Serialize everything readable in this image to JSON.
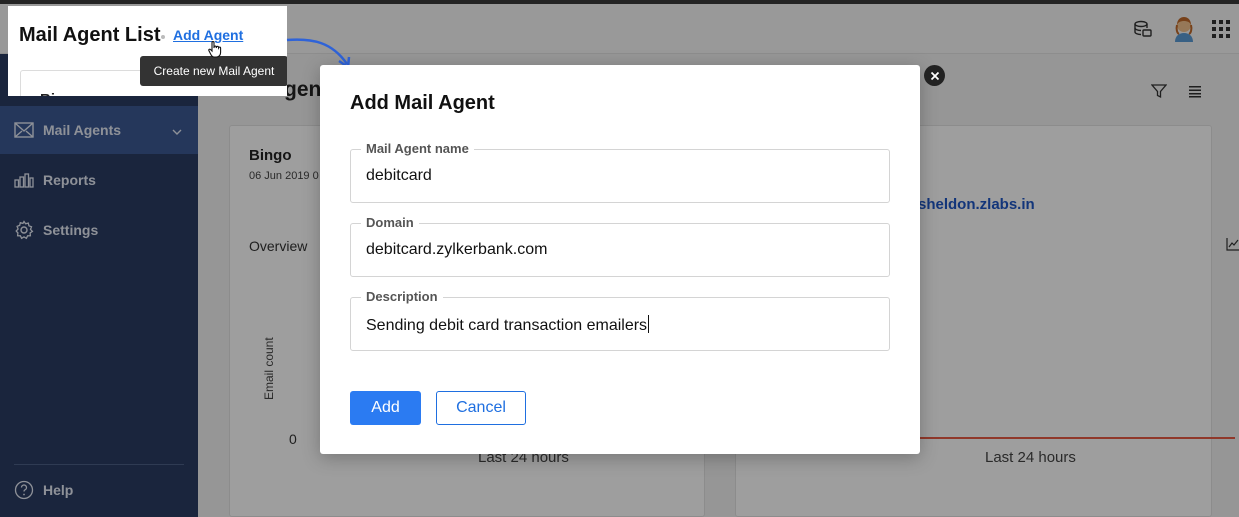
{
  "inset": {
    "title": "Mail Agent List",
    "add_link": "Add Agent",
    "tooltip": "Create new Mail Agent",
    "card_text": "Bi"
  },
  "sidebar": {
    "items": [
      {
        "label": "Mail Agents",
        "icon": "mail-icon"
      },
      {
        "label": "Reports",
        "icon": "reports-icon"
      },
      {
        "label": "Settings",
        "icon": "gear-icon"
      }
    ],
    "help_label": "Help"
  },
  "background": {
    "page_title_fragment": "gent",
    "agent_name": "Bingo",
    "agent_date": "06 Jun 2019 0",
    "overview_tab": "Overview",
    "y_axis_label": "Email count",
    "y_zero": "0",
    "x_label_left": "Last 24 hours",
    "x_label_right": "Last 24 hours",
    "domain_link": "sheldon.zlabs.in"
  },
  "modal": {
    "title": "Add Mail Agent",
    "fields": [
      {
        "label": "Mail Agent name",
        "value": "debitcard"
      },
      {
        "label": "Domain",
        "value": "debitcard.zylkerbank.com"
      },
      {
        "label": "Description",
        "value": "Sending debit card transaction emailers"
      }
    ],
    "add_label": "Add",
    "cancel_label": "Cancel"
  },
  "colors": {
    "sidebar": "#2a3c63",
    "sidebar_active": "#3d5a93",
    "accent": "#2b7bf2",
    "link": "#1f6fe0"
  }
}
